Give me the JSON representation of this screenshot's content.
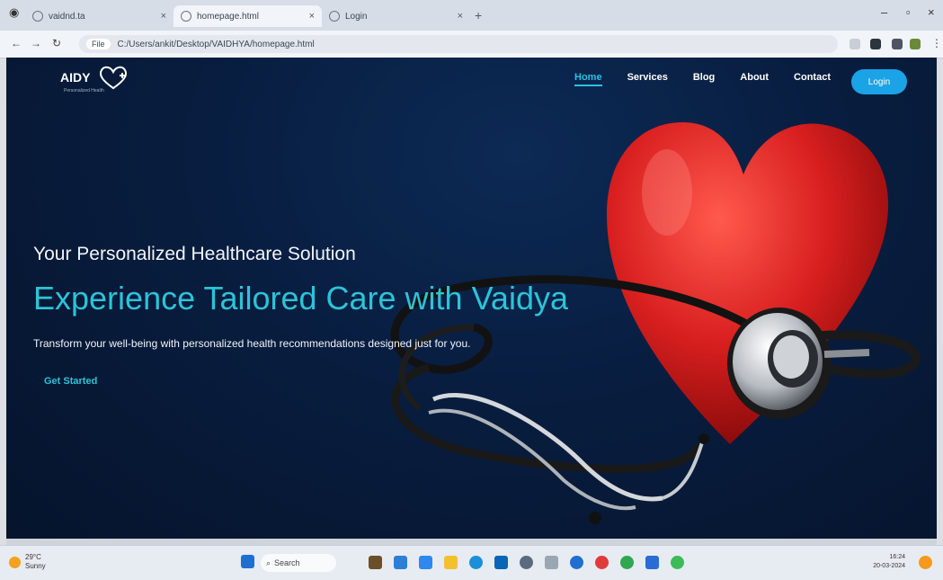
{
  "browser": {
    "tabs": [
      {
        "label": "vaidnd.ta",
        "active": false
      },
      {
        "label": "homepage.html",
        "active": true
      },
      {
        "label": "Login",
        "active": false
      }
    ],
    "new_tab": "+",
    "url": "C:/Users/ankit/Desktop/VAIDHYA/homepage.html",
    "url_chip": "File"
  },
  "site": {
    "logo": "AIDY",
    "logo_tagline": "Personalized Health",
    "nav": [
      {
        "label": "Home",
        "active": true
      },
      {
        "label": "Services",
        "active": false
      },
      {
        "label": "Blog",
        "active": false
      },
      {
        "label": "About",
        "active": false
      },
      {
        "label": "Contact",
        "active": false
      }
    ],
    "login_label": "Login",
    "hero": {
      "subtitle": "Your Personalized Healthcare Solution",
      "title": "Experience Tailored Care with Vaidya",
      "description": "Transform your well-being with personalized health recommendations designed just for you.",
      "cta": "Get Started"
    }
  },
  "taskbar": {
    "weather_temp": "29°C",
    "weather_text": "Sunny",
    "search_placeholder": "Search",
    "time": "16:24",
    "date": "20-03-2024"
  },
  "colors": {
    "accent": "#2cc3d8",
    "login_button": "#1aa3e6",
    "background": "#081d3f",
    "heart": "#d81f1f"
  }
}
